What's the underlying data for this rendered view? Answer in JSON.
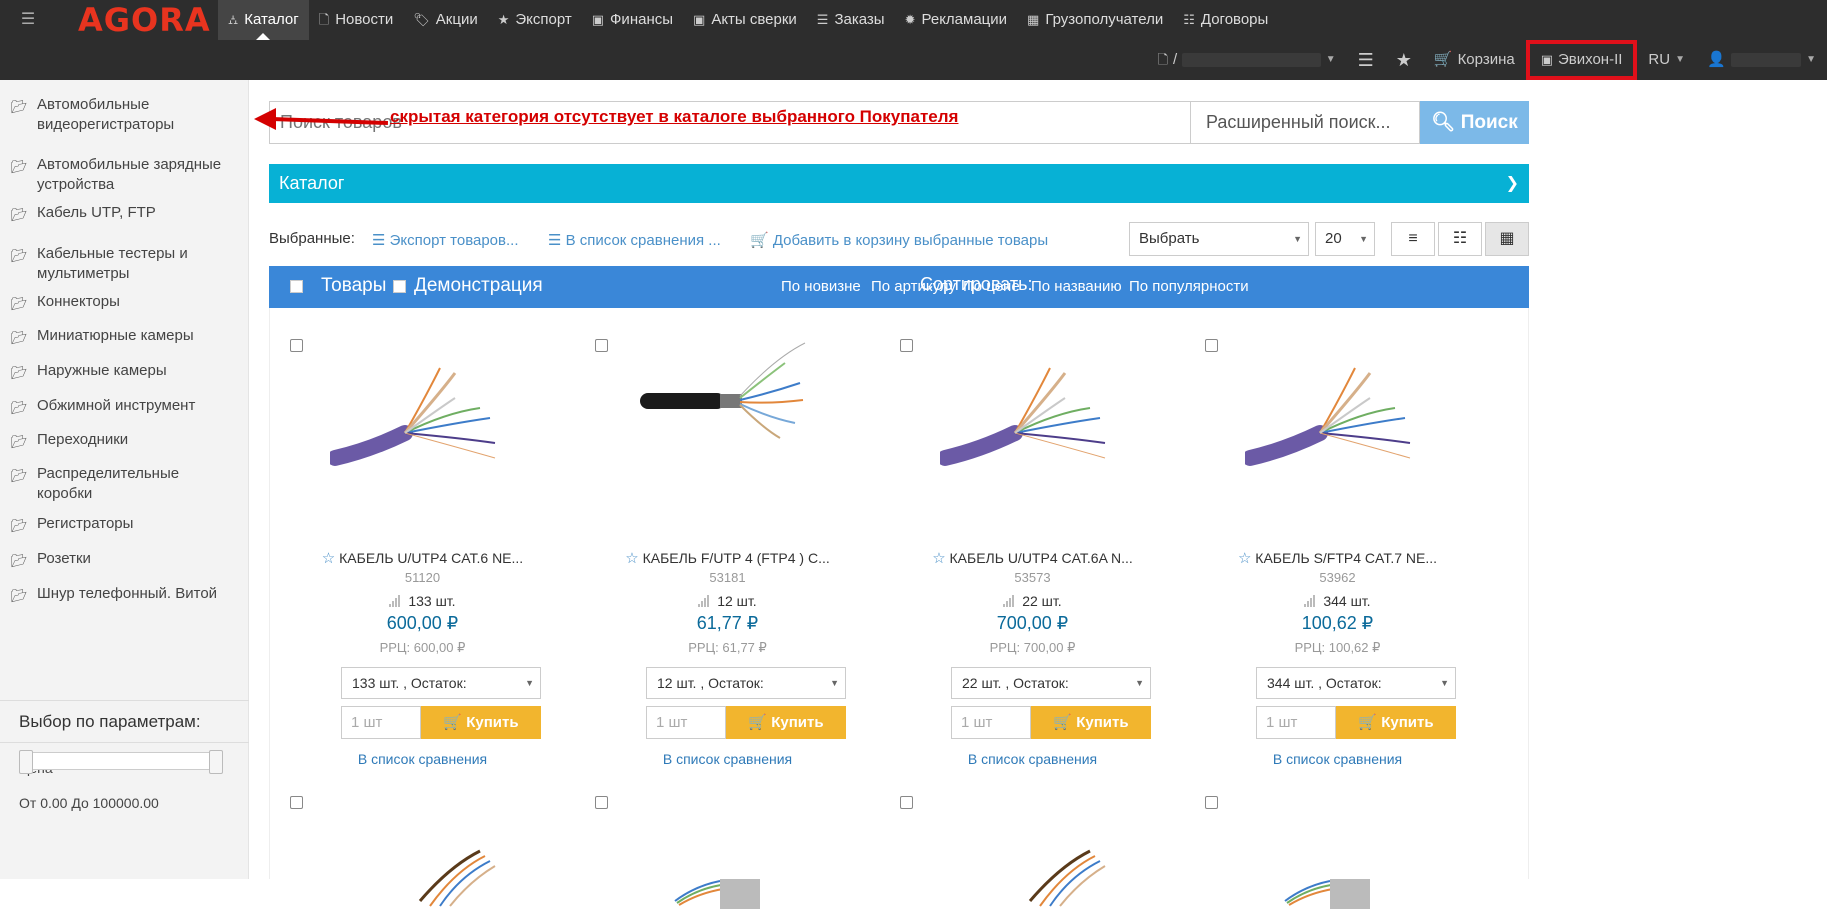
{
  "app": {
    "logo": "AGORA"
  },
  "nav": {
    "primary": [
      {
        "label": "Каталог",
        "icon": "sitemap-icon",
        "glyph": "⛼",
        "active": true
      },
      {
        "label": "Новости",
        "icon": "file-icon",
        "glyph": "🗋"
      },
      {
        "label": "Акции",
        "icon": "tags-icon",
        "glyph": "🏷"
      },
      {
        "label": "Экспорт",
        "icon": "star-icon",
        "glyph": "★"
      },
      {
        "label": "Финансы",
        "icon": "money-icon",
        "glyph": "▣"
      },
      {
        "label": "Акты сверки",
        "icon": "money-icon",
        "glyph": "▣"
      },
      {
        "label": "Заказы",
        "icon": "tasks-icon",
        "glyph": "☰"
      },
      {
        "label": "Рекламации",
        "icon": "gear-icon",
        "glyph": "✹"
      },
      {
        "label": "Грузополучатели",
        "icon": "building-icon",
        "glyph": "▦"
      },
      {
        "label": "Договоры",
        "icon": "list-icon",
        "glyph": "☷"
      }
    ],
    "secondary": {
      "contract_prefix": "/",
      "cart_label": "Корзина",
      "company_label": "Эвихон-II",
      "language": "RU"
    }
  },
  "sidebar": {
    "categories": [
      "Автомобильные видеорегистраторы",
      "Автомобильные зарядные устройства",
      "Кабель UTP, FTP",
      "Кабельные тестеры и мультиметры",
      "Коннекторы",
      "Миниатюрные камеры",
      "Наружные камеры",
      "Обжимной инструмент",
      "Переходники",
      "Распределительные коробки",
      "Регистраторы",
      "Розетки",
      "Шнур телефонный. Витой"
    ],
    "filter_title": "Выбор по параметрам:",
    "price_label": "Цена",
    "price_range": "От 0.00 До 100000.00"
  },
  "search": {
    "placeholder": "Поиск товаров",
    "advanced_label": "Расширенный поиск...",
    "button_label": "Поиск"
  },
  "annotation": {
    "text": "скрытая категория отсутствует в каталоге выбранного Покупателя"
  },
  "catalog_bar": {
    "title": "Каталог"
  },
  "toolbar": {
    "selected_label": "Выбранные:",
    "export_label": "Экспорт товаров...",
    "compare_label": "В список сравнения ...",
    "add_cart_label": "Добавить в корзину выбранные товары",
    "select_value": "Выбрать",
    "per_page": "20"
  },
  "products_header": {
    "goods_label": "Товары",
    "demo_label": "Демонстрация",
    "sort_label": "Сортировать:",
    "sort_options": [
      "По новизне",
      "По артикулу",
      "По цене",
      "По названию",
      "По популярности"
    ]
  },
  "products": [
    {
      "name": "КАБЕЛЬ U/UTP4 CAT.6 NE...",
      "sku": "51120",
      "stock": "133 шт.",
      "price": "600,00 ₽",
      "rrp": "РРЦ: 600,00 ₽",
      "stock_select": "133 шт. , Остаток:",
      "qty_placeholder": "1 шт",
      "buy_label": "Купить",
      "compare_label": "В список сравнения"
    },
    {
      "name": "КАБЕЛЬ F/UTP 4 (FTP4 ) C...",
      "sku": "53181",
      "stock": "12 шт.",
      "price": "61,77 ₽",
      "rrp": "РРЦ: 61,77 ₽",
      "stock_select": "12 шт. , Остаток:",
      "qty_placeholder": "1 шт",
      "buy_label": "Купить",
      "compare_label": "В список сравнения"
    },
    {
      "name": "КАБЕЛЬ U/UTP4 CAT.6A N...",
      "sku": "53573",
      "stock": "22 шт.",
      "price": "700,00 ₽",
      "rrp": "РРЦ: 700,00 ₽",
      "stock_select": "22 шт. , Остаток:",
      "qty_placeholder": "1 шт",
      "buy_label": "Купить",
      "compare_label": "В список сравнения"
    },
    {
      "name": "КАБЕЛЬ S/FTP4 CAT.7 NE...",
      "sku": "53962",
      "stock": "344 шт.",
      "price": "100,62 ₽",
      "rrp": "РРЦ: 100,62 ₽",
      "stock_select": "344 шт. , Остаток:",
      "qty_placeholder": "1 шт",
      "buy_label": "Купить",
      "compare_label": "В список сравнения"
    }
  ],
  "colors": {
    "topbar": "#2d2d2d",
    "logo": "#e8341f",
    "catalog_bar": "#07b1d5",
    "products_header": "#3a87d8",
    "buy_button": "#f2b52e",
    "search_button": "#7cb9e8",
    "annotation": "#d40000",
    "highlight": "#e0101a"
  }
}
